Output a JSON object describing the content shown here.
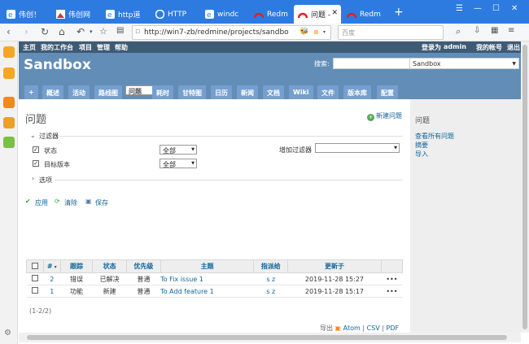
{
  "browser": {
    "tabs": [
      {
        "label": "伟创！",
        "icon": "ie-icon"
      },
      {
        "label": "伟创网",
        "icon": "image-icon"
      },
      {
        "label": "http道",
        "icon": "ie-icon"
      },
      {
        "label": "HTTP",
        "icon": "http-icon"
      },
      {
        "label": "windc",
        "icon": "ie-icon"
      },
      {
        "label": "Redm",
        "icon": "redmine-icon"
      },
      {
        "label": "问题 -",
        "icon": "redmine-icon"
      },
      {
        "label": "Redm",
        "icon": "redmine-icon"
      }
    ],
    "url": "http://win7-zb/redmine/projects/sandbo",
    "search_placeholder": "百度"
  },
  "redmine": {
    "topmenu": {
      "home": "主页",
      "mypage": "我的工作台",
      "projects": "项目",
      "admin": "管理",
      "help": "帮助",
      "logged_as": "登录为",
      "user": "admin",
      "myaccount": "我的帐号",
      "logout": "退出"
    },
    "project_title": "Sandbox",
    "search_label": "搜索:",
    "project_select": "Sandbox",
    "menu": [
      "+",
      "概述",
      "活动",
      "路线图",
      "问题",
      "耗时",
      "甘特图",
      "日历",
      "新闻",
      "文档",
      "Wiki",
      "文件",
      "版本库",
      "配置"
    ],
    "page_title": "问题",
    "new_issue": "新建问题",
    "filters_label": "过滤器",
    "filters": [
      {
        "label": "状态",
        "value": "全部"
      },
      {
        "label": "目标版本",
        "value": "全部"
      }
    ],
    "add_filter_label": "增加过滤器",
    "options_label": "选项",
    "actions": {
      "apply": "应用",
      "clear": "清除",
      "save": "保存"
    },
    "table": {
      "headers": [
        "#",
        "跟踪",
        "状态",
        "优先级",
        "主题",
        "指派给",
        "更新于"
      ],
      "rows": [
        {
          "id": "2",
          "tracker": "错误",
          "status": "已解决",
          "priority": "普通",
          "subject": "To Fix issue 1",
          "assignee": "s z",
          "updated": "2019-11-28 15:27"
        },
        {
          "id": "1",
          "tracker": "功能",
          "status": "新建",
          "priority": "普通",
          "subject": "To Add feature 1",
          "assignee": "s z",
          "updated": "2019-11-28 15:17"
        }
      ]
    },
    "pagination": "(1-2/2)",
    "export": {
      "label": "导出",
      "atom": "Atom",
      "csv": "CSV",
      "pdf": "PDF",
      "sep": "|"
    },
    "sidebar": {
      "title": "问题",
      "links": [
        "查看所有问题",
        "摘要",
        "导入"
      ]
    }
  },
  "colors": {
    "tabbar": "#2d7be0",
    "header": "#628db6",
    "topmenu": "#3e5b76",
    "link": "#116699"
  }
}
